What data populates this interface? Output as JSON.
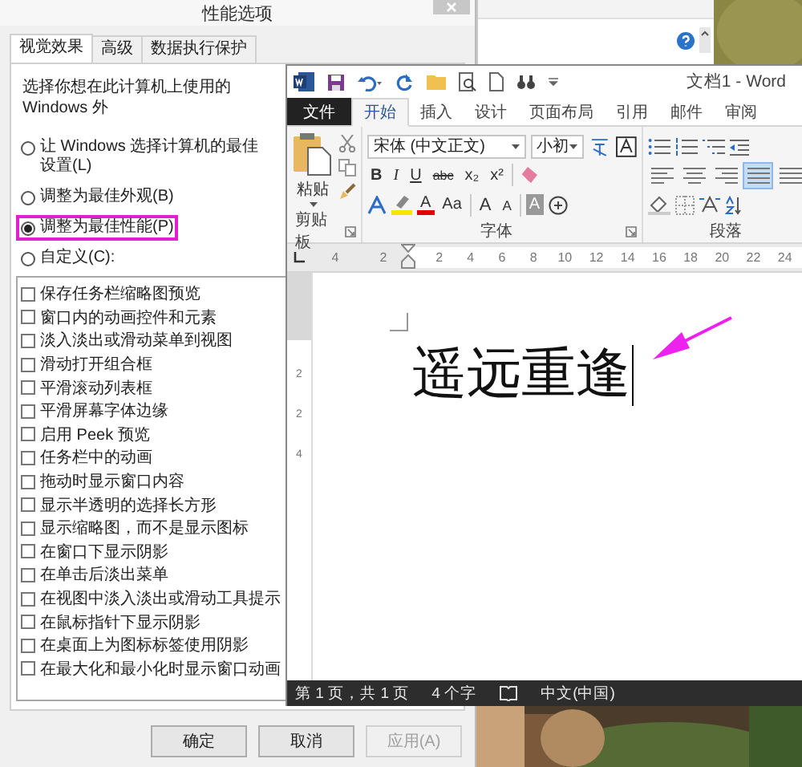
{
  "dialog": {
    "title": "性能选项",
    "tabs": [
      {
        "label": "视觉效果",
        "selected": true
      },
      {
        "label": "高级",
        "selected": false
      },
      {
        "label": "数据执行保护",
        "selected": false
      }
    ],
    "description": "选择你想在此计算机上使用的 Windows 外",
    "radios": [
      {
        "label": "让 Windows 选择计算机的最佳设置(L)",
        "selected": false
      },
      {
        "label": "调整为最佳外观(B)",
        "selected": false
      },
      {
        "label": "调整为最佳性能(P)",
        "selected": true
      },
      {
        "label": "自定义(C):",
        "selected": false
      }
    ],
    "options": [
      {
        "label": "保存任务栏缩略图预览",
        "checked": false
      },
      {
        "label": "窗口内的动画控件和元素",
        "checked": false
      },
      {
        "label": "淡入淡出或滑动菜单到视图",
        "checked": false
      },
      {
        "label": "滑动打开组合框",
        "checked": false
      },
      {
        "label": "平滑滚动列表框",
        "checked": false
      },
      {
        "label": "平滑屏幕字体边缘",
        "checked": false
      },
      {
        "label": "启用 Peek 预览",
        "checked": false
      },
      {
        "label": "任务栏中的动画",
        "checked": false
      },
      {
        "label": "拖动时显示窗口内容",
        "checked": false
      },
      {
        "label": "显示半透明的选择长方形",
        "checked": false
      },
      {
        "label": "显示缩略图，而不是显示图标",
        "checked": false
      },
      {
        "label": "在窗口下显示阴影",
        "checked": false
      },
      {
        "label": "在单击后淡出菜单",
        "checked": false
      },
      {
        "label": "在视图中淡入淡出或滑动工具提示",
        "checked": false
      },
      {
        "label": "在鼠标指针下显示阴影",
        "checked": false
      },
      {
        "label": "在桌面上为图标标签使用阴影",
        "checked": false
      },
      {
        "label": "在最大化和最小化时显示窗口动画",
        "checked": false
      }
    ],
    "buttons": [
      {
        "label": "确定",
        "disabled": false
      },
      {
        "label": "取消",
        "disabled": false
      },
      {
        "label": "应用(A)",
        "disabled": true
      }
    ]
  },
  "word": {
    "title": "文档1 - Word",
    "tabs": [
      {
        "label": "文件",
        "kind": "file",
        "selected": false
      },
      {
        "label": "开始",
        "kind": "tab",
        "selected": true
      },
      {
        "label": "插入",
        "kind": "tab",
        "selected": false
      },
      {
        "label": "设计",
        "kind": "tab",
        "selected": false
      },
      {
        "label": "页面布局",
        "kind": "tab",
        "selected": false
      },
      {
        "label": "引用",
        "kind": "tab",
        "selected": false
      },
      {
        "label": "邮件",
        "kind": "tab",
        "selected": false
      },
      {
        "label": "审阅",
        "kind": "tab",
        "selected": false
      }
    ],
    "paste_label": "粘贴",
    "font_name": "宋体 (中文正文)",
    "font_size": "小初",
    "font_buttons": [
      {
        "label": "B",
        "kind": "bold"
      },
      {
        "label": "I",
        "kind": "italic"
      },
      {
        "label": "U",
        "kind": "underline"
      },
      {
        "label": "abc",
        "kind": "strike"
      },
      {
        "label": "x₂",
        "kind": "sub"
      },
      {
        "label": "x²",
        "kind": "sup"
      },
      {
        "label": "A",
        "kind": "color"
      },
      {
        "label": "Aa",
        "kind": "case"
      },
      {
        "label": "A",
        "kind": "grow"
      },
      {
        "label": "A",
        "kind": "shrink"
      },
      {
        "label": "A",
        "kind": "shade"
      }
    ],
    "align_buttons": [
      {
        "selected": false
      },
      {
        "selected": false
      },
      {
        "selected": false
      },
      {
        "selected": true
      },
      {
        "selected": false
      }
    ],
    "groups": [
      "剪贴板",
      "字体",
      "段落"
    ],
    "ruler_labels": [
      "4",
      "2",
      "2",
      "4",
      "6",
      "8",
      "10",
      "12",
      "14",
      "16",
      "18",
      "20",
      "22",
      "24"
    ],
    "vertical_ruler_labels": [
      "2",
      "2",
      "4"
    ],
    "document_text": "遥远重逢",
    "status": [
      "第 1 页，共 1 页",
      "4 个字",
      "中文(中国)"
    ]
  }
}
